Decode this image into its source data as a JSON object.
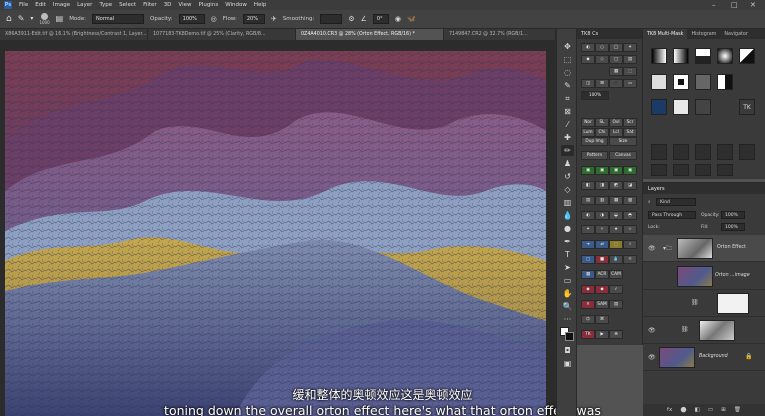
{
  "menu": {
    "app_icon": "Ps",
    "items": [
      "File",
      "Edit",
      "Image",
      "Layer",
      "Type",
      "Select",
      "Filter",
      "3D",
      "View",
      "Plugins",
      "Window",
      "Help"
    ]
  },
  "options": {
    "brush_size": "1000",
    "mode_label": "Mode:",
    "mode_value": "Normal",
    "opacity_label": "Opacity:",
    "opacity_value": "100%",
    "flow_label": "Flow:",
    "flow_value": "20%",
    "smoothing_label": "Smoothing:",
    "angle_value": "0°"
  },
  "doc_tabs": [
    "X86A3911-Edit.tif @ 16.1% (Brightness/Contrast 1, Layer...",
    "1077183-TK8Demo.tif @ 25% (Clarity, RGB/8...",
    "0Z4A4010.CR3 @ 28% (Orton Effect, RGB/16) *",
    "7149847.CR2 @ 32.7% (RGB/1..."
  ],
  "subtitles": {
    "cn": "缓和整体的奥顿效应这是奥顿效应",
    "en": "toning down the overall orton effect here's what that orton effect was"
  },
  "tk8": {
    "title": "TK8 Cs",
    "row_labels": [
      "Nor",
      "SL",
      "Ovl",
      "Scr",
      "Lum",
      "Chi",
      "Lcl",
      "Sat"
    ],
    "dup_img": "Dup Img",
    "size": "Size",
    "pattern": "Pattern",
    "canvas": "Canvas",
    "acr": "ACR",
    "cam": "CAM",
    "sam": "SAM",
    "pct": "100%"
  },
  "multimask": {
    "tabs": [
      "TK8 Multi-Mask",
      "Histogram",
      "Navigator"
    ]
  },
  "layers": {
    "title": "Layers",
    "kind_label": "Kind",
    "blend_mode": "Pass Through",
    "opacity_label": "Opacity:",
    "opacity_value": "100%",
    "lock_label": "Lock:",
    "fill_label": "Fill:",
    "fill_value": "100%",
    "items": [
      {
        "name": "Orton Effect"
      },
      {
        "name": "Orton ...image"
      },
      {
        "name": ""
      },
      {
        "name": ""
      },
      {
        "name": "Background"
      }
    ],
    "footer_icons": [
      "fx",
      "⬤",
      "◧",
      "▭",
      "⊞",
      "🗑"
    ]
  },
  "colors": {
    "accent": "#2b5c9e",
    "panel_bg": "#3a3a3a",
    "chrome_bg": "#424242"
  }
}
